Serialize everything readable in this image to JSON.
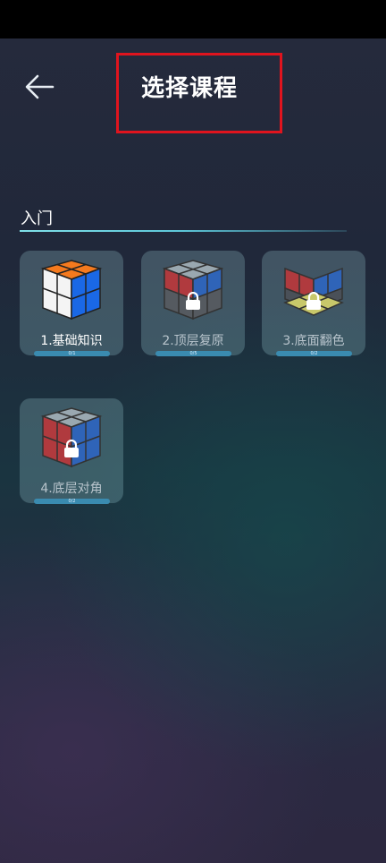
{
  "header": {
    "title": "选择课程"
  },
  "section": {
    "title": "入门"
  },
  "courses": [
    {
      "label": "1.基础知识",
      "progress_text": "0/1",
      "progress": 0,
      "locked": false
    },
    {
      "label": "2.顶层复原",
      "progress_text": "0/5",
      "progress": 0,
      "locked": true
    },
    {
      "label": "3.底面翻色",
      "progress_text": "0/2",
      "progress": 0,
      "locked": true
    },
    {
      "label": "4.底层对角",
      "progress_text": "0/2",
      "progress": 0,
      "locked": true
    }
  ],
  "colors": {
    "highlight_border": "#e0141e",
    "progress_bar": "#3a8bb0"
  },
  "icons": {
    "back": "back-arrow-icon",
    "lock": "lock-icon"
  }
}
